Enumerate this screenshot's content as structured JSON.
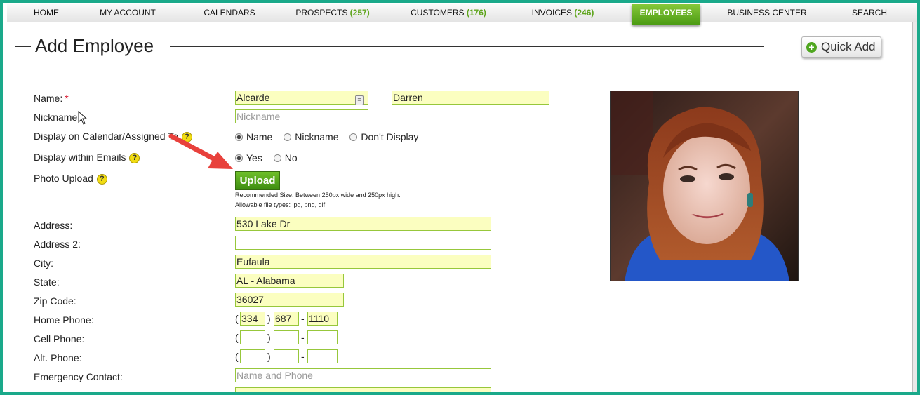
{
  "nav": {
    "items": [
      {
        "label": "HOME",
        "count": ""
      },
      {
        "label": "MY ACCOUNT",
        "count": ""
      },
      {
        "label": "CALENDARS",
        "count": ""
      },
      {
        "label": "PROSPECTS",
        "count": "(257)"
      },
      {
        "label": "CUSTOMERS",
        "count": "(176)"
      },
      {
        "label": "INVOICES",
        "count": "(246)"
      },
      {
        "label": "EMPLOYEES",
        "count": ""
      },
      {
        "label": "BUSINESS CENTER",
        "count": ""
      },
      {
        "label": "SEARCH",
        "count": ""
      }
    ],
    "active": "EMPLOYEES",
    "accent_color": "#5ea51c"
  },
  "page": {
    "title": "Add Employee",
    "quick_add_label": "Quick Add"
  },
  "form": {
    "name_label": "Name:",
    "required_mark": "*",
    "last_name": "Alcarde",
    "first_name": "Darren",
    "nickname_label": "Nickname:",
    "nickname_placeholder": "Nickname",
    "display_calendar_label": "Display on Calendar/Assigned To",
    "display_calendar_options": [
      "Name",
      "Nickname",
      "Don't Display"
    ],
    "display_calendar_selected": "Name",
    "display_emails_label": "Display within Emails",
    "display_emails_options": [
      "Yes",
      "No"
    ],
    "display_emails_selected": "Yes",
    "photo_upload_label": "Photo Upload",
    "upload_button": "Upload",
    "upload_note_size": "Recommended Size: Between 250px wide and 250px high.",
    "upload_note_types": "Allowable file types: jpg, png, gif",
    "address_label": "Address:",
    "address": "530 Lake Dr",
    "address2_label": "Address 2:",
    "address2": "",
    "city_label": "City:",
    "city": "Eufaula",
    "state_label": "State:",
    "state": "AL - Alabama",
    "zip_label": "Zip Code:",
    "zip": "36027",
    "home_phone_label": "Home Phone:",
    "home_phone": {
      "area": "334",
      "prefix": "687",
      "line": "1110"
    },
    "cell_phone_label": "Cell Phone:",
    "cell_phone": {
      "area": "",
      "prefix": "",
      "line": ""
    },
    "alt_phone_label": "Alt. Phone:",
    "alt_phone": {
      "area": "",
      "prefix": "",
      "line": ""
    },
    "emergency_label": "Emergency Contact:",
    "emergency_placeholder": "Name and Phone",
    "paren_open": "(",
    "paren_close": ")",
    "dash": "-",
    "help_glyph": "?"
  },
  "icons": {
    "quick_add": "plus-circle-icon",
    "help": "help-question-icon",
    "annotation": "red-arrow-icon",
    "cursor": "mouse-pointer-icon"
  }
}
